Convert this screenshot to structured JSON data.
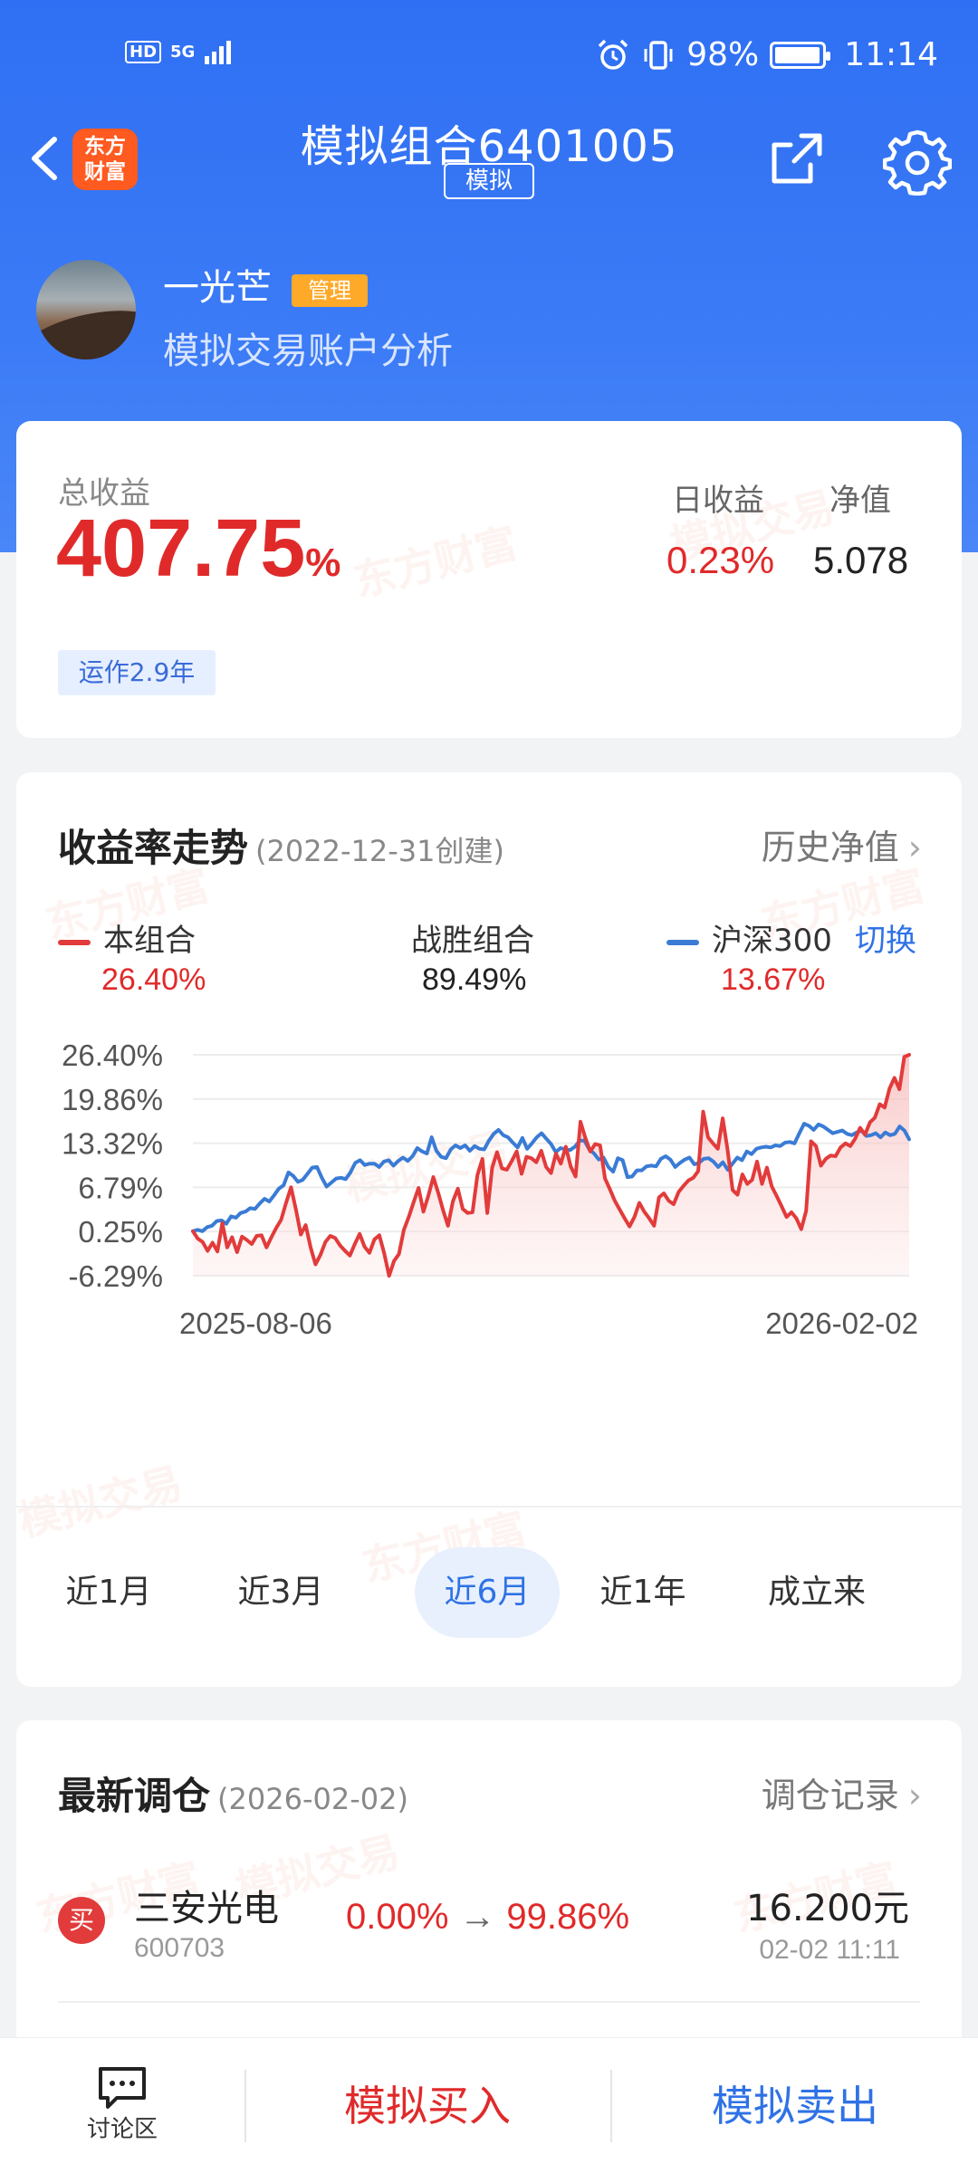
{
  "status_bar": {
    "hd": "HD",
    "network": "5G",
    "battery": "98%",
    "battery_level": 0.98,
    "time": "11:14"
  },
  "nav": {
    "brand_line1": "东方",
    "brand_line2": "财富",
    "title": "模拟组合6401005",
    "tag": "模拟"
  },
  "profile": {
    "name": "一光芒",
    "badge": "管理",
    "description": "模拟交易账户分析"
  },
  "summary": {
    "total_label": "总收益",
    "total_value": "407.75",
    "total_unit": "%",
    "run_badge": "运作2.9年",
    "daily_label": "日收益",
    "daily_value": "0.23%",
    "nav_label": "净值",
    "nav_value": "5.078"
  },
  "trend": {
    "title": "收益率走势",
    "created": "(2022-12-31创建)",
    "history_link": "历史净值",
    "legend": [
      {
        "label": "本组合",
        "value": "26.40%",
        "color": "#e23b3b"
      },
      {
        "label": "战胜组合",
        "value": "89.49%"
      },
      {
        "label": "沪深300",
        "value": "13.67%",
        "color": "#3a7bd5"
      }
    ],
    "switch_label": "切换",
    "range_tabs": [
      "近1月",
      "近3月",
      "近6月",
      "近1年",
      "成立来"
    ],
    "active_tab": 2
  },
  "chart_data": {
    "type": "line",
    "ytick_labels": [
      "26.40%",
      "19.86%",
      "13.32%",
      "6.79%",
      "0.25%",
      "-6.29%"
    ],
    "yticks": [
      26.4,
      19.86,
      13.32,
      6.79,
      0.25,
      -6.29
    ],
    "ylim": [
      -6.29,
      26.4
    ],
    "x_start_label": "2025-08-06",
    "x_end_label": "2026-02-02",
    "grid": true,
    "series": [
      {
        "name": "本组合",
        "color": "#e23b3b",
        "fill": true,
        "values": [
          0.3,
          -0.8,
          -1.3,
          -2.6,
          -1.4,
          -2.7,
          1.5,
          -2.1,
          -0.6,
          -2.8,
          -0.5,
          -1.0,
          -1.6,
          -0.4,
          -0.3,
          -2.1,
          -0.6,
          0.8,
          2.0,
          4.5,
          6.8,
          3.5,
          -0.2,
          1.2,
          -2.1,
          -4.6,
          -3.2,
          -1.3,
          -0.4,
          -0.7,
          -1.8,
          -2.6,
          -3.3,
          -1.6,
          -0.1,
          -2.0,
          -2.9,
          -0.9,
          -0.3,
          -3.0,
          -6.3,
          -4.1,
          -3.1,
          0.5,
          2.4,
          4.6,
          6.7,
          3.2,
          5.6,
          8.3,
          6.0,
          3.4,
          1.1,
          4.7,
          6.6,
          3.6,
          3.0,
          3.1,
          8.6,
          11.0,
          3.0,
          9.7,
          12.0,
          9.6,
          9.4,
          10.7,
          12.1,
          8.8,
          11.3,
          11.1,
          10.5,
          12.2,
          9.8,
          8.9,
          11.8,
          10.3,
          12.8,
          9.9,
          8.4,
          16.5,
          14.1,
          12.1,
          13.2,
          13.0,
          8.1,
          6.5,
          4.8,
          3.5,
          2.2,
          1.0,
          2.4,
          4.5,
          3.2,
          2.2,
          1.1,
          5.3,
          5.9,
          4.8,
          4.3,
          6.1,
          7.0,
          7.8,
          8.2,
          9.2,
          18.0,
          14.2,
          13.3,
          12.5,
          17.0,
          12.3,
          6.4,
          5.7,
          8.7,
          7.3,
          7.9,
          10.6,
          7.3,
          9.7,
          6.9,
          5.5,
          4.0,
          2.4,
          3.1,
          2.2,
          0.6,
          3.3,
          13.6,
          12.9,
          10.0,
          11.0,
          11.5,
          11.4,
          12.7,
          13.3,
          12.9,
          14.0,
          15.6,
          14.6,
          16.4,
          17.1,
          19.1,
          18.6,
          21.4,
          23.0,
          21.3,
          26.1,
          26.4
        ]
      },
      {
        "name": "沪深300",
        "color": "#3a7bd5",
        "fill": false,
        "values": [
          0.3,
          0.5,
          0.3,
          0.9,
          1.1,
          1.8,
          1.9,
          1.4,
          2.5,
          2.3,
          3.0,
          3.2,
          3.7,
          3.6,
          4.4,
          5.1,
          4.7,
          5.6,
          6.6,
          7.1,
          9.0,
          8.5,
          7.6,
          7.9,
          8.8,
          9.7,
          9.8,
          8.2,
          6.9,
          7.5,
          8.1,
          8.2,
          8.0,
          9.0,
          10.4,
          10.8,
          10.1,
          10.3,
          10.3,
          9.8,
          10.6,
          10.8,
          10.0,
          10.7,
          11.2,
          10.7,
          11.4,
          12.6,
          12.1,
          11.8,
          14.2,
          12.2,
          11.3,
          11.1,
          12.4,
          13.0,
          12.6,
          13.0,
          12.2,
          12.9,
          12.5,
          12.4,
          13.7,
          14.7,
          15.3,
          14.5,
          14.2,
          13.4,
          12.7,
          14.1,
          12.5,
          13.3,
          14.2,
          14.8,
          14.0,
          13.2,
          12.0,
          12.6,
          12.4,
          12.3,
          12.8,
          13.7,
          13.7,
          12.4,
          11.8,
          10.9,
          11.2,
          9.8,
          9.1,
          11.1,
          10.8,
          8.3,
          8.4,
          9.3,
          9.3,
          9.9,
          10.0,
          9.9,
          11.0,
          11.4,
          10.9,
          9.8,
          10.4,
          10.9,
          11.2,
          10.2,
          10.4,
          11.0,
          11.1,
          10.6,
          9.8,
          10.5,
          9.4,
          10.3,
          11.2,
          10.8,
          12.1,
          11.7,
          12.5,
          12.7,
          12.8,
          12.7,
          13.0,
          12.9,
          13.4,
          13.5,
          13.3,
          14.8,
          16.2,
          15.9,
          15.3,
          16.1,
          15.8,
          15.3,
          14.8,
          15.0,
          15.2,
          14.7,
          14.5,
          14.9,
          15.2,
          14.4,
          14.5,
          14.8,
          14.2,
          14.9,
          14.5,
          14.7,
          15.8,
          15.2,
          13.9
        ]
      }
    ]
  },
  "trade": {
    "title": "最新调仓",
    "date": "(2026-02-02)",
    "records_link": "调仓记录",
    "rows": [
      {
        "action": "买",
        "name": "三安光电",
        "code": "600703",
        "from": "0.00%",
        "arrow": "→",
        "to": "99.86%",
        "price": "16.200元",
        "time": "02-02  11:11"
      }
    ]
  },
  "bottom": {
    "discuss": "讨论区",
    "buy": "模拟买入",
    "sell": "模拟卖出"
  },
  "watermarks": [
    "东方财富",
    "模拟交易"
  ],
  "colors": {
    "header_blue": "#2f6ff3",
    "red": "#e02a2a",
    "blue": "#2f72e6",
    "badge_orange": "#ffa929",
    "brand_orange": "#ff5a1f"
  }
}
